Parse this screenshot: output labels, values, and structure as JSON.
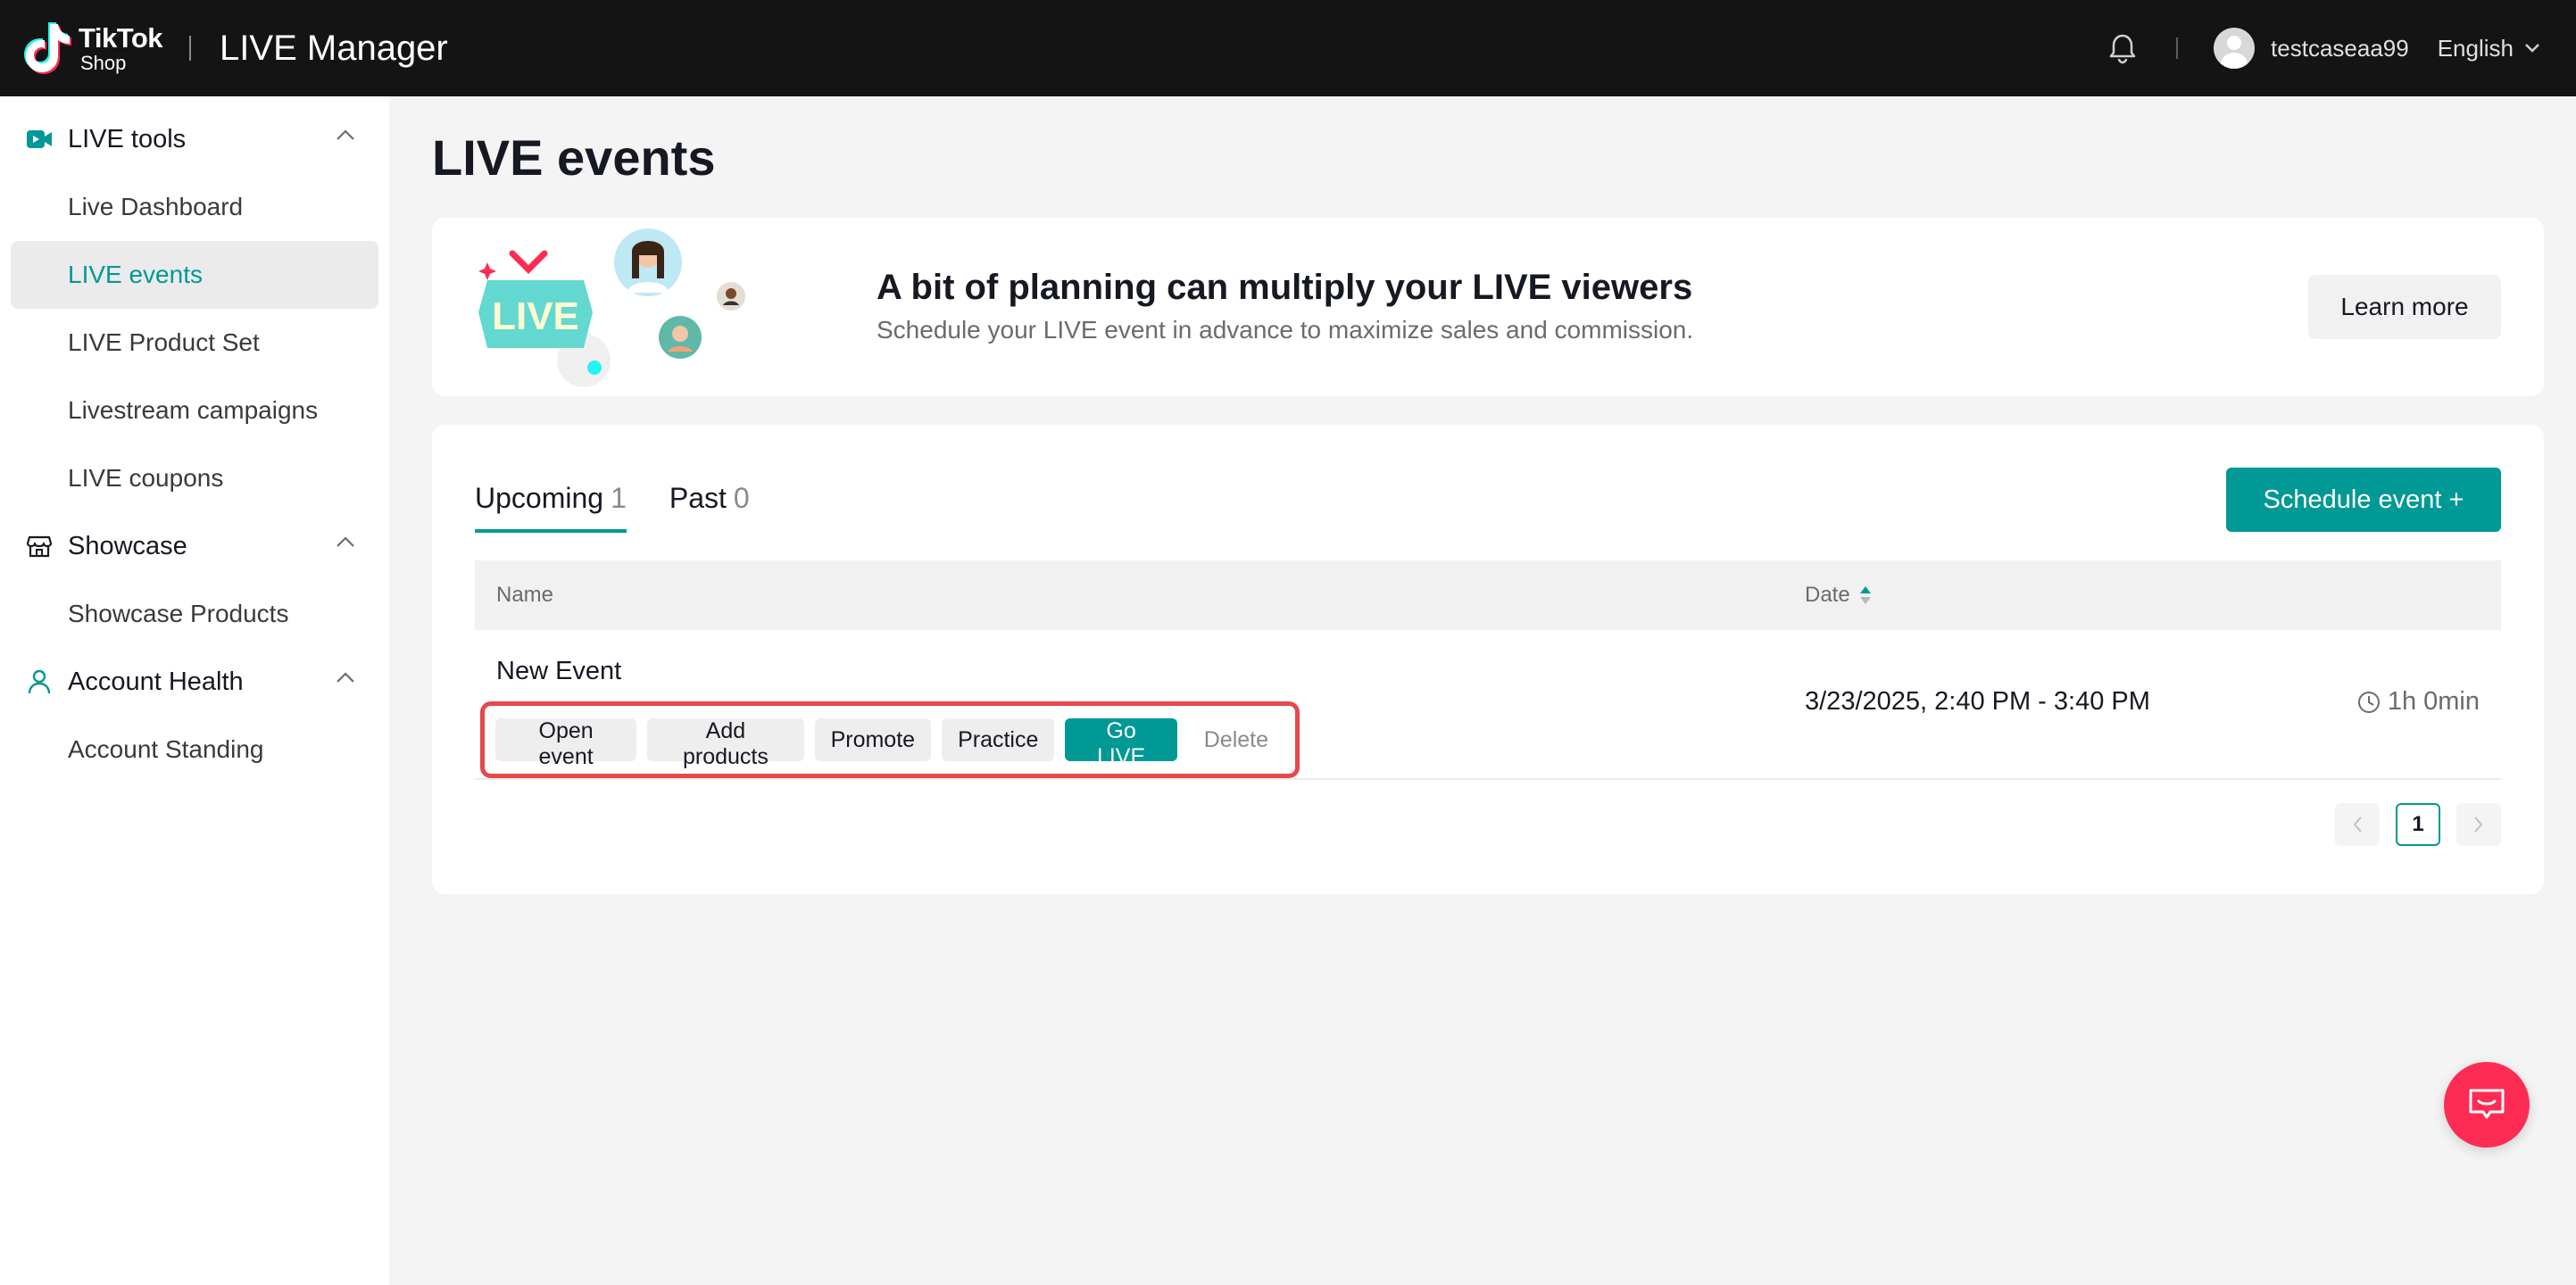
{
  "header": {
    "brand": "TikTok",
    "brand_sub": "Shop",
    "title": "LIVE Manager",
    "username": "testcaseaa99",
    "language": "English"
  },
  "sidebar": {
    "groups": [
      {
        "label": "LIVE tools",
        "icon": "video-icon",
        "items": [
          "Live Dashboard",
          "LIVE events",
          "LIVE Product Set",
          "Livestream campaigns",
          "LIVE coupons"
        ]
      },
      {
        "label": "Showcase",
        "icon": "store-icon",
        "items": [
          "Showcase Products"
        ]
      },
      {
        "label": "Account Health",
        "icon": "person-icon",
        "items": [
          "Account Standing"
        ]
      }
    ],
    "active_item": "LIVE events"
  },
  "main": {
    "page_title": "LIVE events",
    "banner": {
      "badge_text": "LIVE",
      "heading": "A bit of planning can multiply your LIVE viewers",
      "subtext": "Schedule your LIVE event in advance to maximize sales and commission.",
      "button": "Learn more"
    },
    "tabs": [
      {
        "label": "Upcoming",
        "count": "1",
        "active": true
      },
      {
        "label": "Past",
        "count": "0",
        "active": false
      }
    ],
    "schedule_button": "Schedule event +",
    "table": {
      "columns": [
        "Name",
        "Date"
      ],
      "rows": [
        {
          "name": "New Event",
          "actions": [
            "Open event",
            "Add products",
            "Promote",
            "Practice",
            "Go LIVE",
            "Delete"
          ],
          "date": "3/23/2025, 2:40 PM - 3:40 PM",
          "duration": "1h 0min"
        }
      ]
    },
    "pagination": {
      "current": "1"
    }
  },
  "colors": {
    "accent": "#009995",
    "highlight": "#e5484d",
    "fab": "#fe2c55",
    "topbar": "#141414"
  }
}
